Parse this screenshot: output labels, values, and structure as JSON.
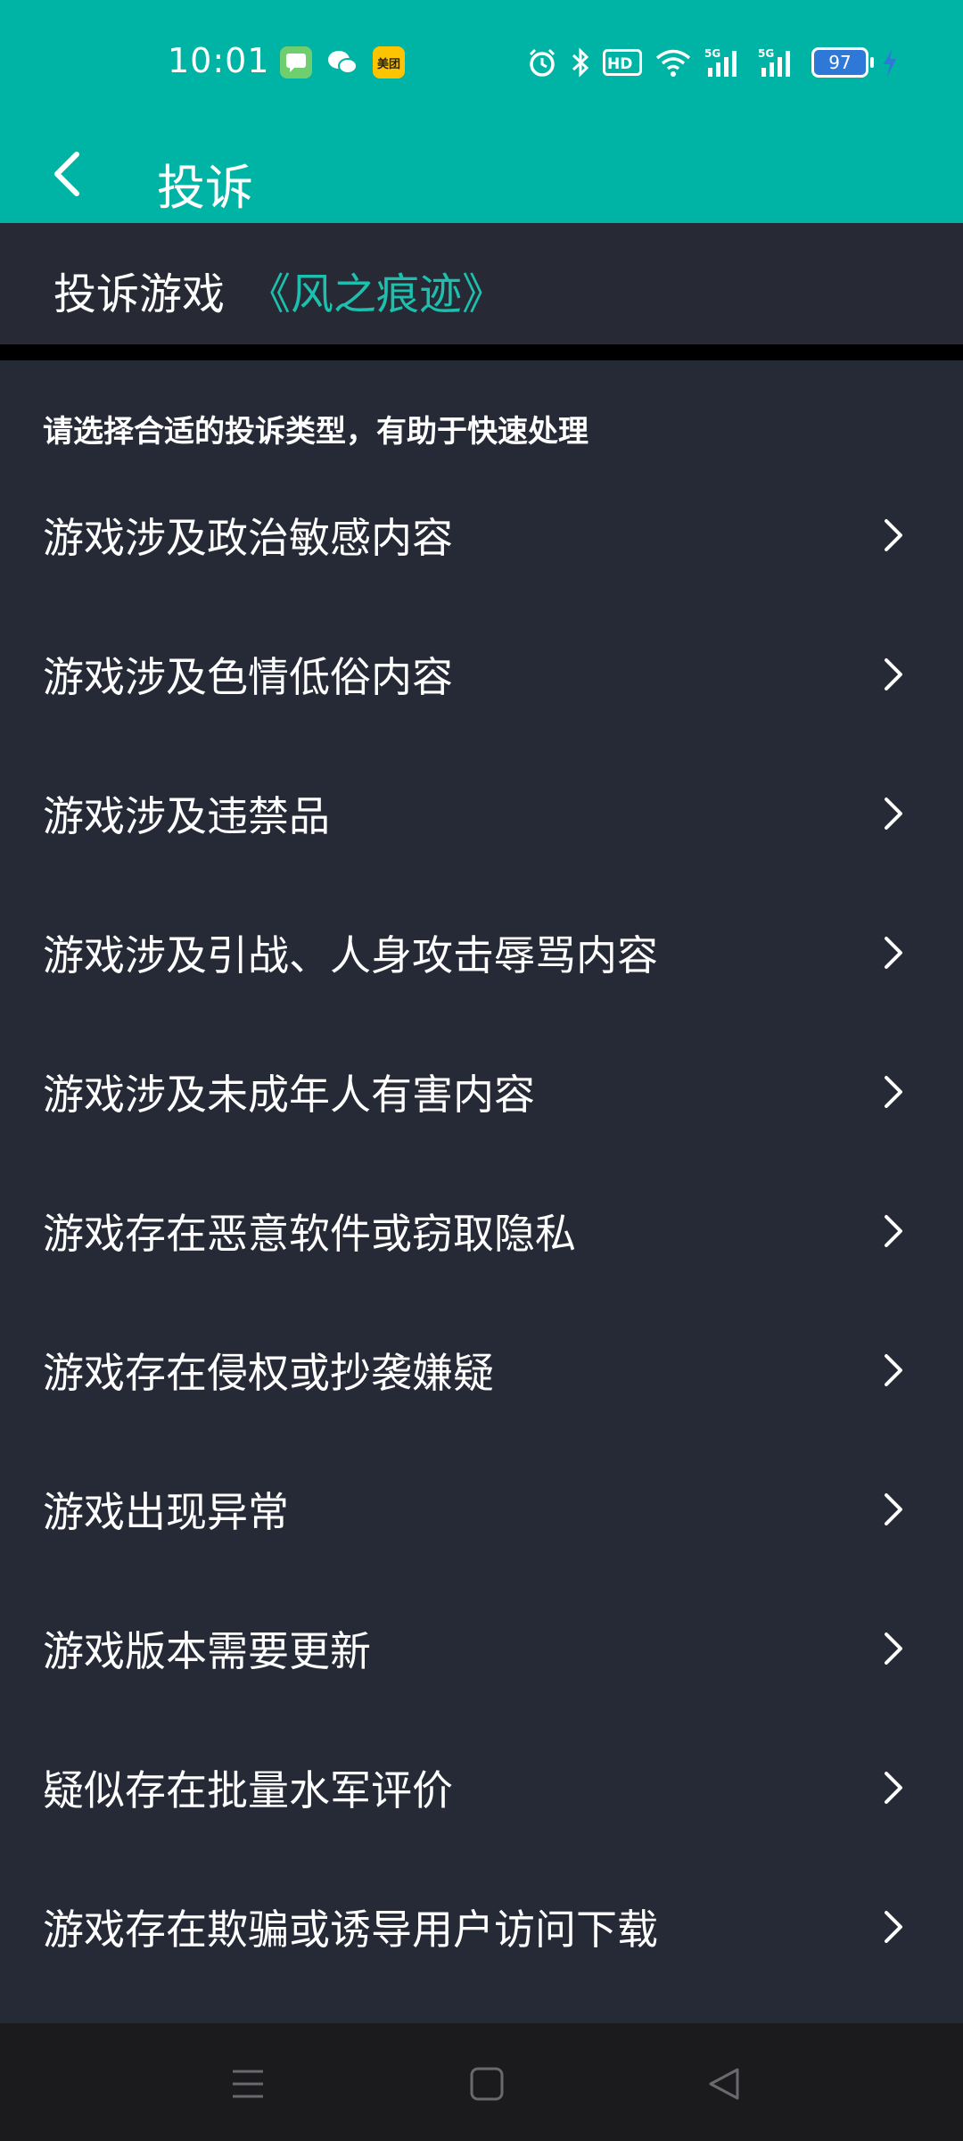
{
  "status_bar": {
    "time": "10:01",
    "notifications": [
      "message-icon",
      "wechat-icon",
      "meituan-icon"
    ],
    "meituan_label": "美团",
    "battery_level": "97",
    "network_label": "5G"
  },
  "title_bar": {
    "title": "投诉"
  },
  "game_header": {
    "label": "投诉游戏",
    "game_name": "《风之痕迹》"
  },
  "hint": "请选择合适的投诉类型，有助于快速处理",
  "complaint_types": [
    "游戏涉及政治敏感内容",
    "游戏涉及色情低俗内容",
    "游戏涉及违禁品",
    "游戏涉及引战、人身攻击辱骂内容",
    "游戏涉及未成年人有害内容",
    "游戏存在恶意软件或窃取隐私",
    "游戏存在侵权或抄袭嫌疑",
    "游戏出现异常",
    "游戏版本需要更新",
    "疑似存在批量水军评价",
    "游戏存在欺骗或诱导用户访问下载"
  ],
  "colors": {
    "accent": "#00b4a5",
    "game_name": "#1dbfae",
    "background": "#262936"
  }
}
